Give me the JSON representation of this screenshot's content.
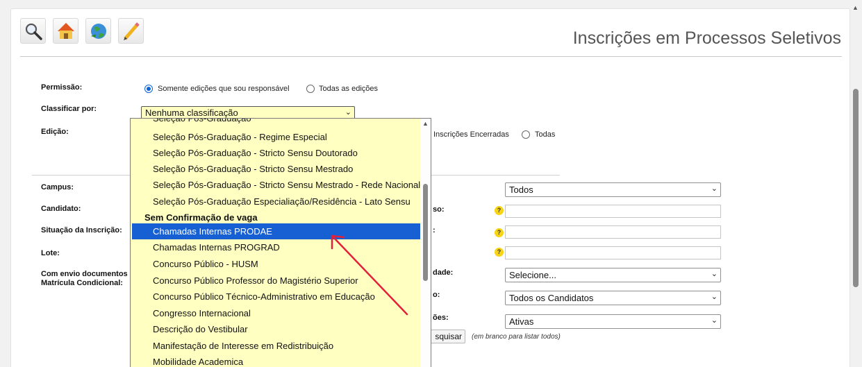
{
  "header": {
    "title": "Inscrições em Processos Seletivos"
  },
  "toolbar": {
    "icons": [
      "search-icon",
      "home-icon",
      "globe-icon",
      "edit-icon"
    ]
  },
  "form": {
    "permissao_label": "Permissão:",
    "permissao_opt1": "Somente edições que sou responsável",
    "permissao_opt2": "Todas as edições",
    "classificar_label": "Classificar por:",
    "classificar_value": "Nenhuma classificação",
    "edicao_label": "Edição:",
    "edicao_opt1": "Inscrições Encerradas",
    "edicao_opt2": "Todas",
    "campus_label": "Campus:",
    "candidato_label": "Candidato:",
    "situacao_label": "Situação da Inscrição:",
    "lote_label": "Lote:",
    "envio_label_1": "Com envio documentos",
    "envio_label_2": "Matrícula Condicional:",
    "partial_so": "so:",
    "partial_colon": ":",
    "partial_dade": "dade:",
    "partial_o": "o:",
    "partial_oes": "ões:",
    "campus_select": "Todos",
    "selecione_select": "Selecione...",
    "candidatos_select": "Todos os Candidatos",
    "ativas_select": "Ativas",
    "pesquisar_btn": "Pesquisar",
    "pesquisar_visible": "squisar",
    "hint": "(em branco para listar todos)"
  },
  "dropdown": {
    "partial_top": "Seleção Pós-Graduação",
    "items_a": [
      "Seleção Pós-Graduação - Regime Especial",
      "Seleção Pós-Graduação - Stricto Sensu Doutorado",
      "Seleção Pós-Graduação - Stricto Sensu Mestrado",
      "Seleção Pós-Graduação - Stricto Sensu Mestrado - Rede Nacional",
      "Seleção Pós-Graduação Especialiação/Residência - Lato Sensu"
    ],
    "group": "Sem Confirmação de vaga",
    "items_b": [
      "Chamadas Internas PRODAE",
      "Chamadas Internas PROGRAD",
      "Concurso Público - HUSM",
      "Concurso Público Professor do Magistério Superior",
      "Concurso Público Técnico-Administrativo em Educação",
      "Congresso Internacional",
      "Descrição do Vestibular",
      "Manifestação de Interesse em Redistribuição",
      "Mobilidade Academica"
    ],
    "highlighted": "Chamadas Internas PRODAE"
  },
  "colors": {
    "highlight": "#1660d3",
    "dropdown_bg": "#ffffc2",
    "annotation_arrow": "#e3203a"
  }
}
